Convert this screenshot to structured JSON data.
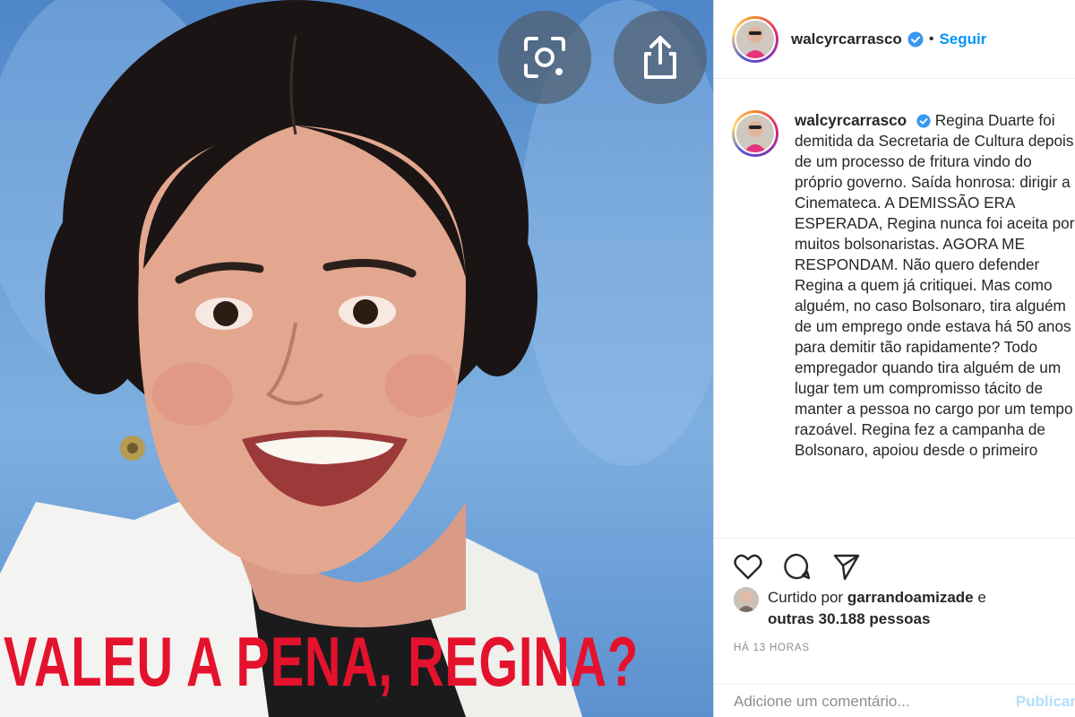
{
  "post": {
    "image_overlay_text": "VALEU A PENA, REGINA?",
    "lens_button_icon": "visual-search-icon",
    "share_button_icon": "share-icon"
  },
  "header": {
    "username": "walcyrcarrasco",
    "verified_icon": "verified-badge-icon",
    "separator": "•",
    "follow_label": "Seguir"
  },
  "caption": {
    "username": "walcyrcarrasco",
    "text": "Regina Duarte foi demitida da Secretaria de Cultura depois de um processo de fritura vindo do próprio governo. Saída honrosa: dirigir a Cinemateca. A DEMISSÃO ERA ESPERADA, Regina nunca foi aceita por muitos bolsonaristas. AGORA ME RESPONDAM. Não quero defender Regina a quem já critiquei. Mas como alguém, no caso Bolsonaro, tira alguém de um emprego onde estava há 50 anos para demitir tão rapidamente? Todo empregador quando tira alguém de um lugar tem um compromisso tácito de manter a pessoa no cargo por um tempo razoável. Regina fez a campanha de Bolsonaro, apoiou desde o primeiro"
  },
  "actions": {
    "like_icon": "heart-icon",
    "comment_icon": "comment-icon",
    "share_icon": "paper-plane-icon"
  },
  "likes": {
    "prefix": "Curtido por",
    "user": "garrandoamizade",
    "conjunction": "e",
    "others": "outras 30.188 pessoas"
  },
  "timestamp": "HÁ 13 HORAS",
  "comment_box": {
    "placeholder": "Adicione um comentário...",
    "publish_label": "Publicar"
  },
  "colors": {
    "accent_blue": "#0095f6",
    "overlay_red": "#e5122d",
    "muted_gray": "#8e8e8e"
  }
}
